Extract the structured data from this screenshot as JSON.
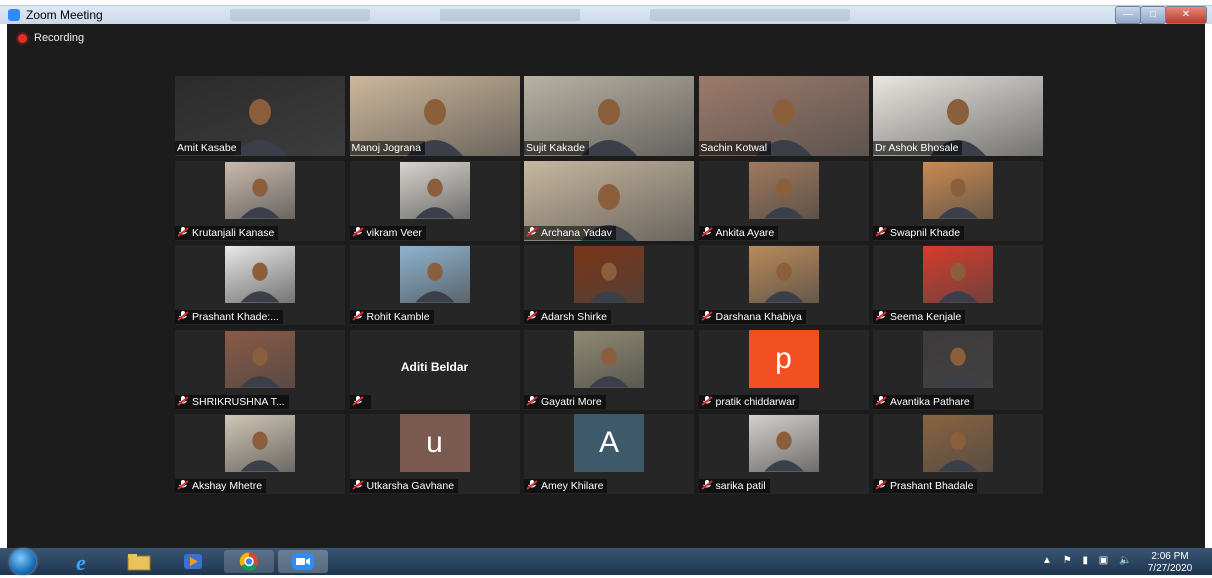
{
  "window": {
    "title": "Zoom Meeting"
  },
  "recording": {
    "label": "Recording"
  },
  "participants": [
    {
      "name": "Amit Kasabe",
      "muted": false,
      "video": true,
      "bg": "#2b2b2b"
    },
    {
      "name": "Manoj Jograna",
      "muted": false,
      "video": true,
      "bg": "#cdb79b"
    },
    {
      "name": "Sujit Kakade",
      "muted": false,
      "video": true,
      "bg": "#b9b2a3",
      "speaking": true
    },
    {
      "name": "Sachin Kotwal",
      "muted": false,
      "video": true,
      "bg": "#9c7a6a"
    },
    {
      "name": "Dr Ashok Bhosale",
      "muted": false,
      "video": true,
      "bg": "#e9e6e0"
    },
    {
      "name": "Krutanjali Kanase",
      "muted": true,
      "video": true,
      "bg": "#c9b9ad"
    },
    {
      "name": "vikram Veer",
      "muted": true,
      "video": true,
      "bg": "#d8d4ce"
    },
    {
      "name": "Archana Yadav",
      "muted": true,
      "video": true,
      "bg": "#c7b79f"
    },
    {
      "name": "Ankita Ayare",
      "muted": true,
      "video": true,
      "bg": "#a0785c"
    },
    {
      "name": "Swapnil Khade",
      "muted": true,
      "video": true,
      "bg": "#c98b52"
    },
    {
      "name": "Prashant Khade:...",
      "muted": true,
      "video": true,
      "bg": "#e8e8e8"
    },
    {
      "name": "Rohit Kamble",
      "muted": true,
      "video": true,
      "bg": "#8fb4cf"
    },
    {
      "name": "Adarsh Shirke",
      "muted": true,
      "video": true,
      "bg": "#7a3516"
    },
    {
      "name": "Darshana Khabiya",
      "muted": true,
      "video": true,
      "bg": "#b98a5a"
    },
    {
      "name": "Seema Kenjale",
      "muted": true,
      "video": true,
      "bg": "#d83b2c"
    },
    {
      "name": "SHRIKRUSHNA T...",
      "muted": true,
      "video": true,
      "bg": "#8a5a45"
    },
    {
      "name": "Aditi Beldar",
      "muted": true,
      "video": false,
      "bg": "#262626"
    },
    {
      "name": "Gayatri More",
      "muted": true,
      "video": true,
      "bg": "#8f8a70"
    },
    {
      "name": "pratik chiddarwar",
      "muted": true,
      "video": false,
      "avatar": "p",
      "bg": "#f25022"
    },
    {
      "name": "Avantika Pathare",
      "muted": true,
      "video": true,
      "bg": "#3d3a3c"
    },
    {
      "name": "Akshay Mhetre",
      "muted": true,
      "video": true,
      "bg": "#cfc6b5"
    },
    {
      "name": "Utkarsha Gavhane",
      "muted": true,
      "video": false,
      "avatar": "u",
      "bg": "#7b5a4f"
    },
    {
      "name": "Amey Khilare",
      "muted": true,
      "video": false,
      "avatar": "A",
      "bg": "#3e5a6a"
    },
    {
      "name": "sarika patil",
      "muted": true,
      "video": true,
      "bg": "#d5d0cc"
    },
    {
      "name": "Prashant Bhadale",
      "muted": true,
      "video": true,
      "bg": "#8a6340"
    }
  ],
  "taskbar": {
    "icons": [
      "windows-start-icon",
      "internet-explorer-icon",
      "file-explorer-icon",
      "media-player-icon",
      "chrome-icon",
      "zoom-icon"
    ]
  },
  "clock": {
    "time": "2:06 PM",
    "date": "7/27/2020"
  }
}
